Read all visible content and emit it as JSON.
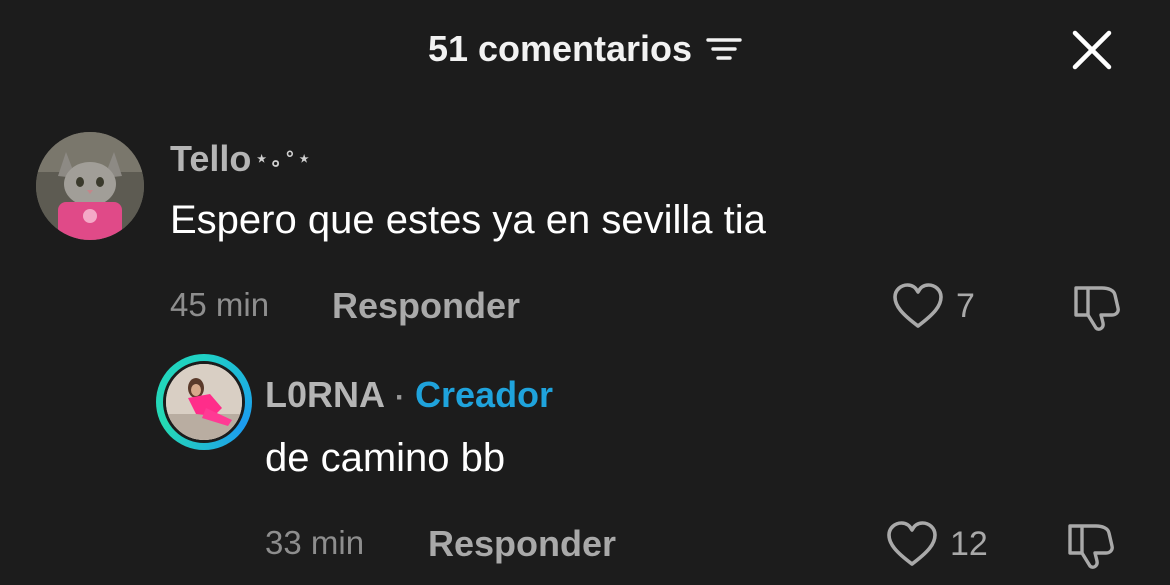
{
  "header": {
    "title": "51 comentarios",
    "filter_icon": "sort-lines-icon",
    "close_icon": "close-x-icon"
  },
  "comments": [
    {
      "username": "Tello",
      "username_decoration": "⋆｡°⋆",
      "text": "Espero que estes ya en sevilla tia",
      "time": "45 min",
      "reply_label": "Responder",
      "likes": "7",
      "avatar_icon": "cat-avatar"
    },
    {
      "username": "L0RNA",
      "separator": "·",
      "badge": "Creador",
      "text": "de camino bb",
      "time": "33 min",
      "reply_label": "Responder",
      "likes": "12",
      "avatar_icon": "creator-avatar"
    }
  ],
  "colors": {
    "background": "#1c1c1c",
    "creator_badge": "#1fa3dc",
    "ring": "#1fd1c5"
  }
}
